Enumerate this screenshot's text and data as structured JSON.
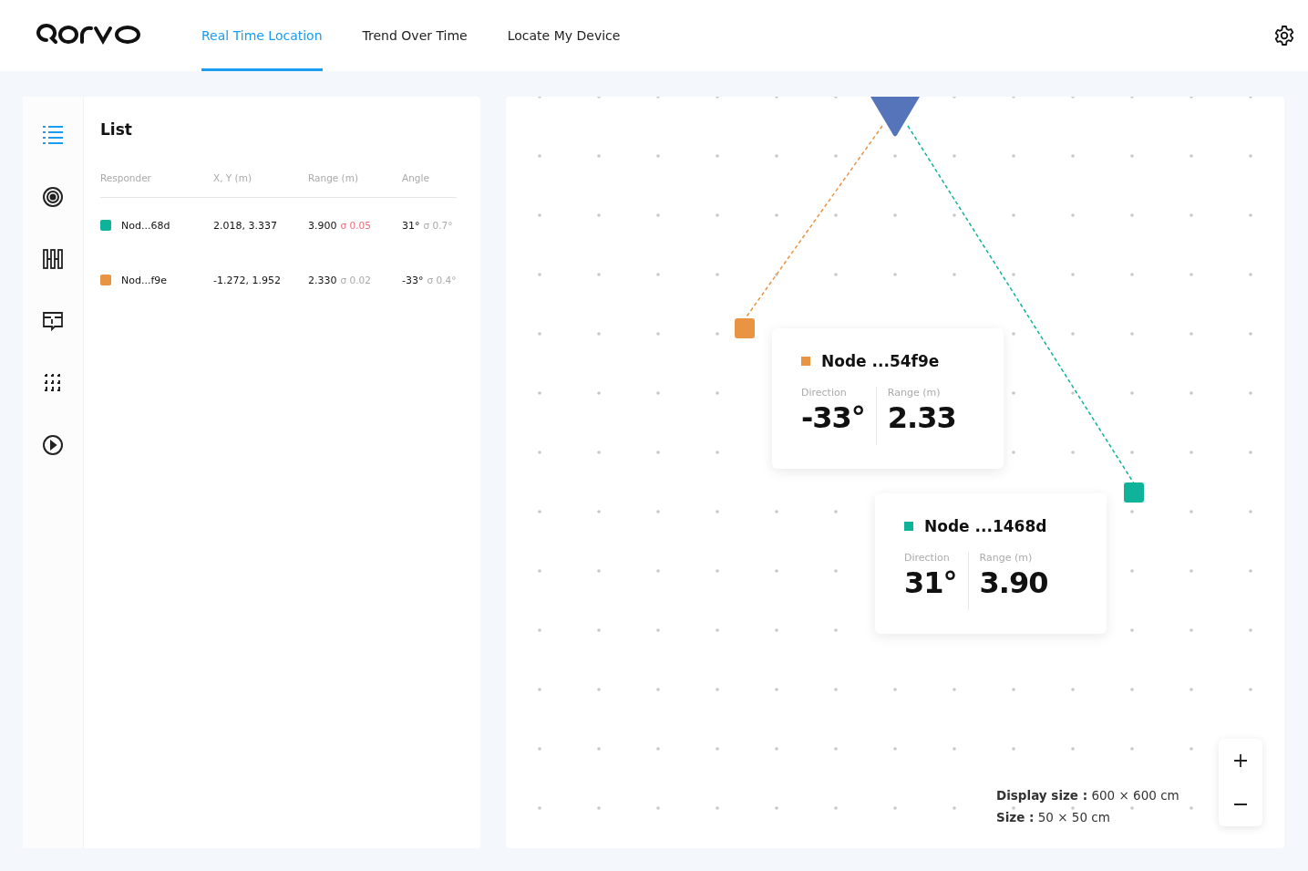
{
  "tabs": [
    {
      "label": "Real Time Location",
      "selected": true
    },
    {
      "label": "Trend Over Time",
      "selected": false
    },
    {
      "label": "Locate My Device",
      "selected": false
    }
  ],
  "sidebar": {
    "items": [
      {
        "selected": true
      },
      {
        "selected": false
      },
      {
        "selected": false
      },
      {
        "selected": false
      },
      {
        "selected": false
      },
      {
        "selected": false
      }
    ]
  },
  "list": {
    "title": "List",
    "columns": [
      "Responder",
      "X, Y (m)",
      "Range (m)",
      "Angle"
    ],
    "rows": [
      {
        "color": "#0fb39a",
        "name": "Nod...68d",
        "xy": "2.018, 3.337",
        "range": "3.900",
        "range_sigma": "σ 0.05",
        "range_warning": true,
        "angle": "31°",
        "angle_sigma": "σ 0.7°"
      },
      {
        "color": "#e89443",
        "name": "Nod...f9e",
        "xy": "-1.272, 1.952",
        "range": "2.330",
        "range_sigma": "σ 0.02",
        "range_warning": false,
        "angle": "-33°",
        "angle_sigma": "σ 0.4°"
      }
    ]
  },
  "map": {
    "cards": [
      {
        "color": "#e89443",
        "title": "Node ...54f9e",
        "direction_label": "Direction",
        "direction": "-33°",
        "range_label": "Range (m)",
        "range": "2.33"
      },
      {
        "color": "#0fb39a",
        "title": "Node ...1468d",
        "direction_label": "Direction",
        "direction": "31°",
        "range_label": "Range (m)",
        "range": "3.90"
      }
    ],
    "display_size": "**Display size :** 600 × 600 cm",
    "size": "**Size :** 50 × 50 cm"
  }
}
